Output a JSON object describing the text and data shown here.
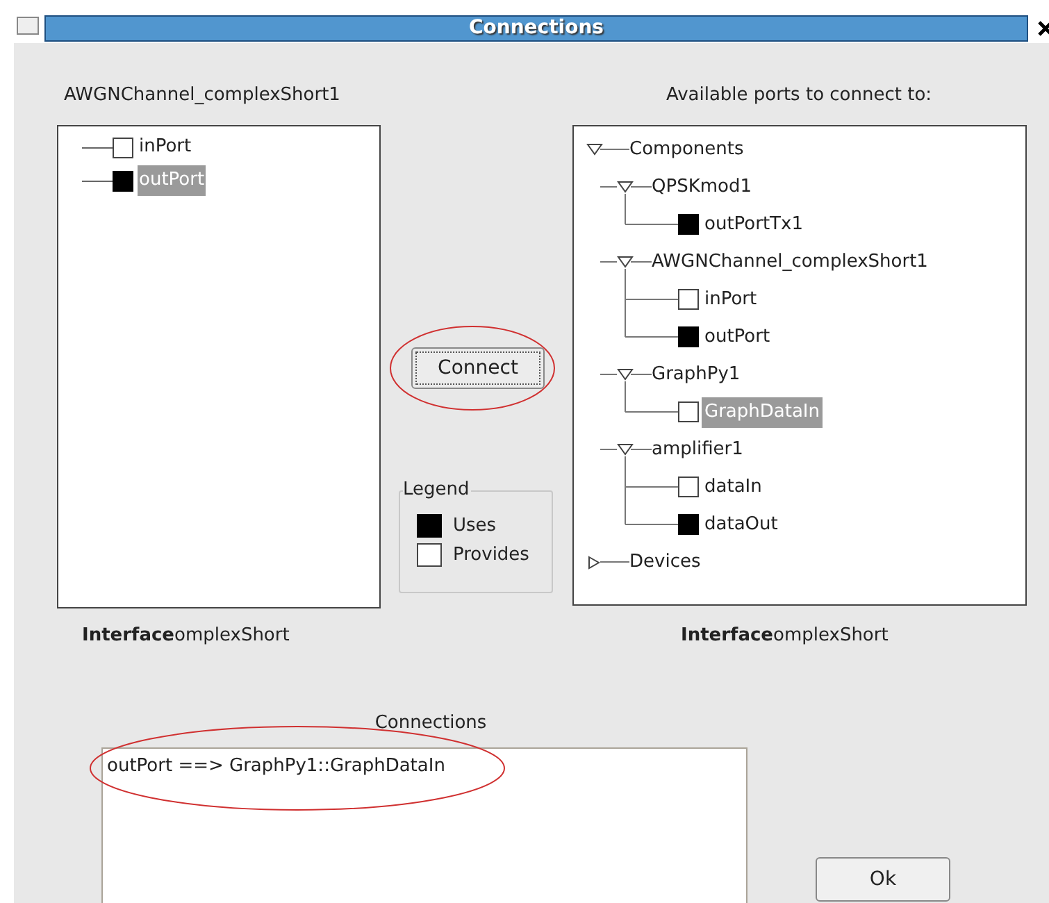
{
  "window": {
    "title": "Connections"
  },
  "component_label": "AWGNChannel_complexShort1",
  "component_ports": [
    {
      "label": "inPort",
      "filled": false,
      "selected": false
    },
    {
      "label": "outPort",
      "filled": true,
      "selected": true
    }
  ],
  "available_label": "Available ports to connect to:",
  "available_tree": [
    {
      "label": "Components",
      "kind": "group",
      "expanded": true,
      "children": [
        {
          "label": "QPSKmod1",
          "kind": "group",
          "expanded": true,
          "children": [
            {
              "label": "outPortTx1",
              "kind": "port",
              "filled": true,
              "selected": false
            }
          ]
        },
        {
          "label": "AWGNChannel_complexShort1",
          "kind": "group",
          "expanded": true,
          "children": [
            {
              "label": "inPort",
              "kind": "port",
              "filled": false,
              "selected": false
            },
            {
              "label": "outPort",
              "kind": "port",
              "filled": true,
              "selected": false
            }
          ]
        },
        {
          "label": "GraphPy1",
          "kind": "group",
          "expanded": true,
          "children": [
            {
              "label": "GraphDataIn",
              "kind": "port",
              "filled": false,
              "selected": true
            }
          ]
        },
        {
          "label": "amplifier1",
          "kind": "group",
          "expanded": true,
          "children": [
            {
              "label": "dataIn",
              "kind": "port",
              "filled": false,
              "selected": false
            },
            {
              "label": "dataOut",
              "kind": "port",
              "filled": true,
              "selected": false
            }
          ]
        }
      ]
    },
    {
      "label": "Devices",
      "kind": "group",
      "expanded": false
    }
  ],
  "connect_button": "Connect",
  "legend": {
    "title": "Legend",
    "items": [
      {
        "label": "Uses",
        "filled": true
      },
      {
        "label": "Provides",
        "filled": false
      }
    ]
  },
  "left_interface": "**Interface**omplexShort",
  "right_interface": "**Interface**omplexShort",
  "connections_label": "Connections",
  "connections": [
    "outPort ==> GraphPy1::GraphDataIn"
  ],
  "ok_button": "Ok"
}
